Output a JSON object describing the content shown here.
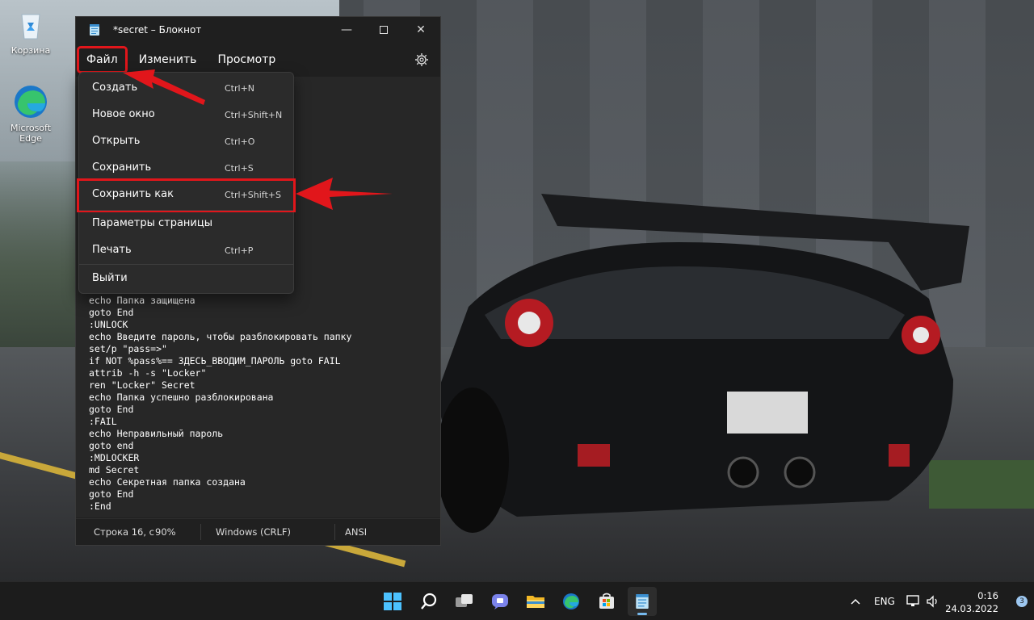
{
  "desktop": {
    "icons": [
      {
        "label": "Корзина"
      },
      {
        "label": "Microsoft Edge"
      }
    ]
  },
  "notepad": {
    "title": "*secret – Блокнот",
    "menu": [
      "Файл",
      "Изменить",
      "Просмотр"
    ],
    "file_menu": [
      {
        "label": "Создать",
        "shortcut": "Ctrl+N"
      },
      {
        "label": "Новое окно",
        "shortcut": "Ctrl+Shift+N"
      },
      {
        "label": "Открыть",
        "shortcut": "Ctrl+O"
      },
      {
        "label": "Сохранить",
        "shortcut": "Ctrl+S"
      },
      {
        "label": "Сохранить как",
        "shortcut": "Ctrl+Shift+S"
      },
      {
        "label": "Параметры страницы",
        "shortcut": ""
      },
      {
        "label": "Печать",
        "shortcut": "Ctrl+P"
      },
      {
        "label": "Выйти",
        "shortcut": ""
      }
    ],
    "content": "echo Папка защищена\ngoto End\n:UNLOCK\necho Введите пароль, чтобы разблокировать папку\nset/p \"pass=>\"\nif NOT %pass%== ЗДЕСЬ_ВВОДИМ_ПАРОЛЬ goto FAIL\nattrib -h -s \"Locker\"\nren \"Locker\" Secret\necho Папка успешно разблокирована\ngoto End\n:FAIL\necho Неправильный пароль\ngoto end\n:MDLOCKER\nmd Secret\necho Секретная папка создана\ngoto End\n:End",
    "status": {
      "position": "Строка 16, с",
      "zoom": "90%",
      "line_ending": "Windows (CRLF)",
      "encoding": "ANSI"
    }
  },
  "taskbar": {
    "apps": [
      "windows-start",
      "search",
      "task-view",
      "teams-chat",
      "file-explorer",
      "edge",
      "store",
      "notepad"
    ],
    "language": "ENG",
    "time": "0:16",
    "date": "24.03.2022",
    "notifications": "3"
  },
  "colors": {
    "highlight": "#e1161b",
    "window_bg": "#1f1f1f",
    "menu_bg": "#2b2b2b",
    "taskbar_bg": "#1c1c1c",
    "accent": "#76b9ed"
  }
}
